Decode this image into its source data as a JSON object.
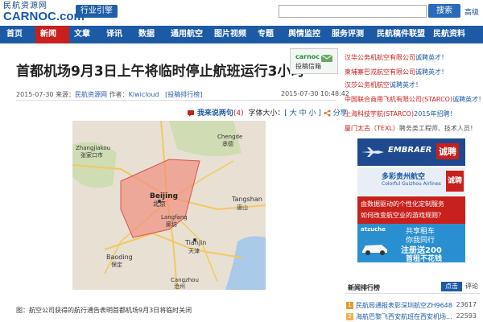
{
  "header": {
    "logo_cn": "民航资源网",
    "logo_en": "CARNOC.com",
    "tagline": "行业引擎",
    "search_placeholder": "",
    "search_button": "搜索",
    "advanced": "高级"
  },
  "nav": [
    {
      "label": "首页"
    },
    {
      "label": "新闻"
    },
    {
      "label": "文章"
    },
    {
      "label": "译讯"
    },
    {
      "label": "数据"
    },
    {
      "label": "通用航空"
    },
    {
      "label": "图片视频"
    },
    {
      "label": "专题"
    },
    {
      "label": "舆情监控"
    },
    {
      "label": "服务评测"
    },
    {
      "label": "民航稿件联盟"
    },
    {
      "label": "民航资料"
    }
  ],
  "article": {
    "title": "首都机场9月3日上午将临时停止航班运行3小时",
    "meta_date": "2015-07-30",
    "meta_source_label": "来源：",
    "meta_source": "民航资源网",
    "meta_author_label": "作者：",
    "meta_author": "Kiwicloud",
    "meta_rank": "[投稿排行榜]",
    "time": "2015-07-30 10:48:42",
    "say_label": "我来说两句",
    "say_count": "(4)",
    "font_label": "字体大小：",
    "font_sizes": "[ 大 中 小 ]",
    "share": "分享",
    "caption": "图：航空公司获得的航行通告表明首都机场9月3日将临时关闭",
    "badge_line1": "carnoc",
    "badge_line2": "投稿信箱"
  },
  "map": {
    "labels": {
      "zhangjiakou_en": "Zhangjiakou",
      "zhangjiakou_cn": "张家口市",
      "chengde_en": "Chengde",
      "chengde_cn": "承德",
      "beijing_en": "Beijing",
      "beijing_cn": "北京",
      "langfang_en": "Langfang",
      "langfang_cn": "廊坊",
      "tangshan_en": "Tangshan",
      "tangshan_cn": "唐山",
      "tianjin_en": "Tianjin",
      "tianjin_cn": "天津",
      "baoding_en": "Baoding",
      "baoding_cn": "保定",
      "cangzhou_en": "Cangzhou",
      "cangzhou_cn": "沧州"
    },
    "colors": {
      "land": "#e7e0d3",
      "water": "#a9c9e8",
      "zone": "#ef8a7a",
      "road": "#f2c95e"
    }
  },
  "recruit": [
    {
      "company": "汉华公务机航空有限公司",
      "link": "诚聘英才！"
    },
    {
      "company": "柬埔寨巴戎航空有限公司",
      "link": "诚聘英才！"
    },
    {
      "company": "汉莎公务机航空",
      "link": "诚聘英才！"
    },
    {
      "company": "中国联合商用飞机有限公司(STARCO)",
      "link": "诚聘英才！"
    },
    {
      "company": "上海科技宇航(STARCO)",
      "link": "2015年招聘！"
    },
    {
      "company": "厦门太古（TEXL）",
      "link": "聘务类工程师、技术人员！"
    }
  ],
  "ads": [
    {
      "text1": "EMBRAER",
      "text2": "诚聘",
      "bg": "#1f4a8f"
    },
    {
      "text1": "多彩贵州航空",
      "text2": "Colorful Guizhou Airlines",
      "text3": "诚聘",
      "bg": "#1d5aa5"
    },
    {
      "text1": "由数据驱动的个性化定制服务",
      "text2": "如何改变航空业的游戏规则？",
      "bg": "#c8201c"
    },
    {
      "text1": "atzuche",
      "text2": "共享租车",
      "text3": "你我同行",
      "text4": "注册送200",
      "text5": "首租不花钱",
      "bg": "#2a8fd0"
    }
  ],
  "ranking": {
    "title": "新闻排行榜",
    "tab_click": "点击",
    "tab_comment": "评论",
    "items": [
      {
        "num": "1",
        "text": "民航局通报表彰深圳航空ZH9648机...",
        "value": "23617"
      },
      {
        "num": "2",
        "text": "海航巴黎飞西安航班在西安机场...",
        "value": "22593"
      }
    ]
  }
}
